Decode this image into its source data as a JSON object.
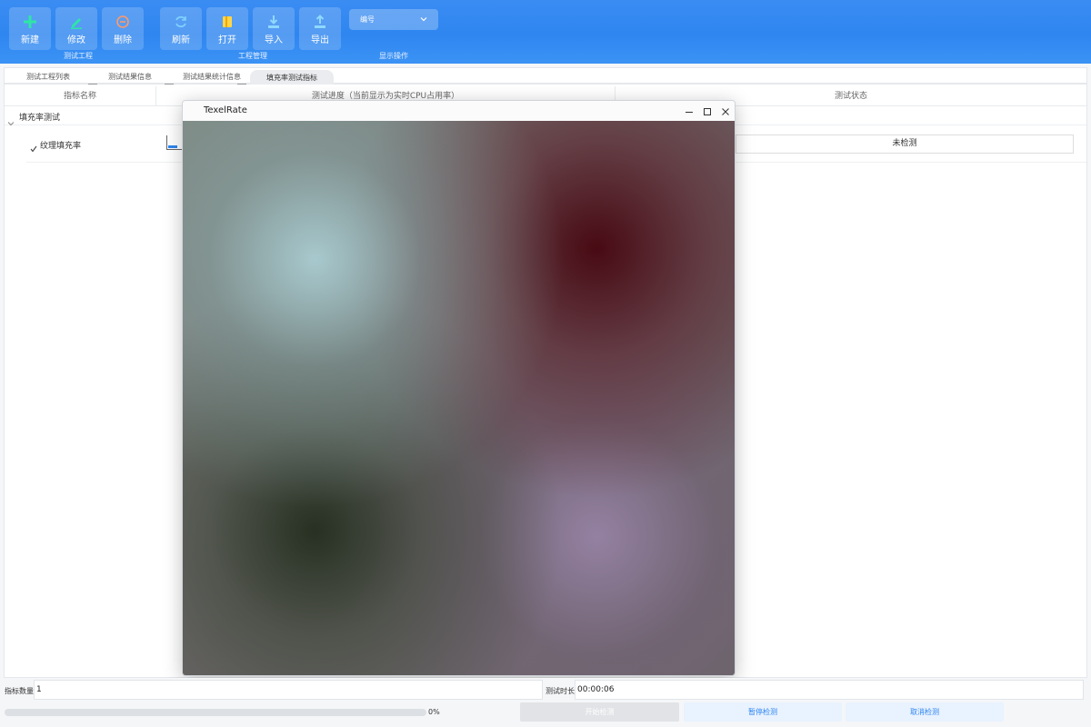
{
  "toolbar": {
    "buttons": [
      {
        "label": "新建",
        "icon": "plus-icon"
      },
      {
        "label": "修改",
        "icon": "pencil-icon"
      },
      {
        "label": "删除",
        "icon": "minus-circle-icon"
      },
      {
        "label": "刷新",
        "icon": "refresh-icon"
      },
      {
        "label": "打开",
        "icon": "open-folder-icon"
      },
      {
        "label": "导入",
        "icon": "import-icon"
      },
      {
        "label": "导出",
        "icon": "export-icon"
      }
    ],
    "groups": {
      "project": "测试工程",
      "manage": "工程管理",
      "display": "显示操作"
    },
    "combo_value": "编号",
    "accent": "#2f86f0"
  },
  "tabs": [
    "测试工程列表",
    "测试结果信息",
    "测试结果统计信息",
    "填充率测试指标"
  ],
  "active_tab": 3,
  "table": {
    "headers": [
      "指标名称",
      "测试进度（当前显示为实时CPU占用率）",
      "测试状态"
    ],
    "group": "填充率测试",
    "item": {
      "name": "纹理填充率",
      "status": "未检测"
    }
  },
  "window": {
    "title": "TexelRate"
  },
  "footer": {
    "count_label": "指标数量",
    "count_value": "1",
    "duration_label": "测试时长",
    "duration_value": "00:00:06",
    "progress_text": "0%",
    "progress": 0,
    "start": "开始检测",
    "pause": "暂停检测",
    "cancel": "取消检测"
  }
}
